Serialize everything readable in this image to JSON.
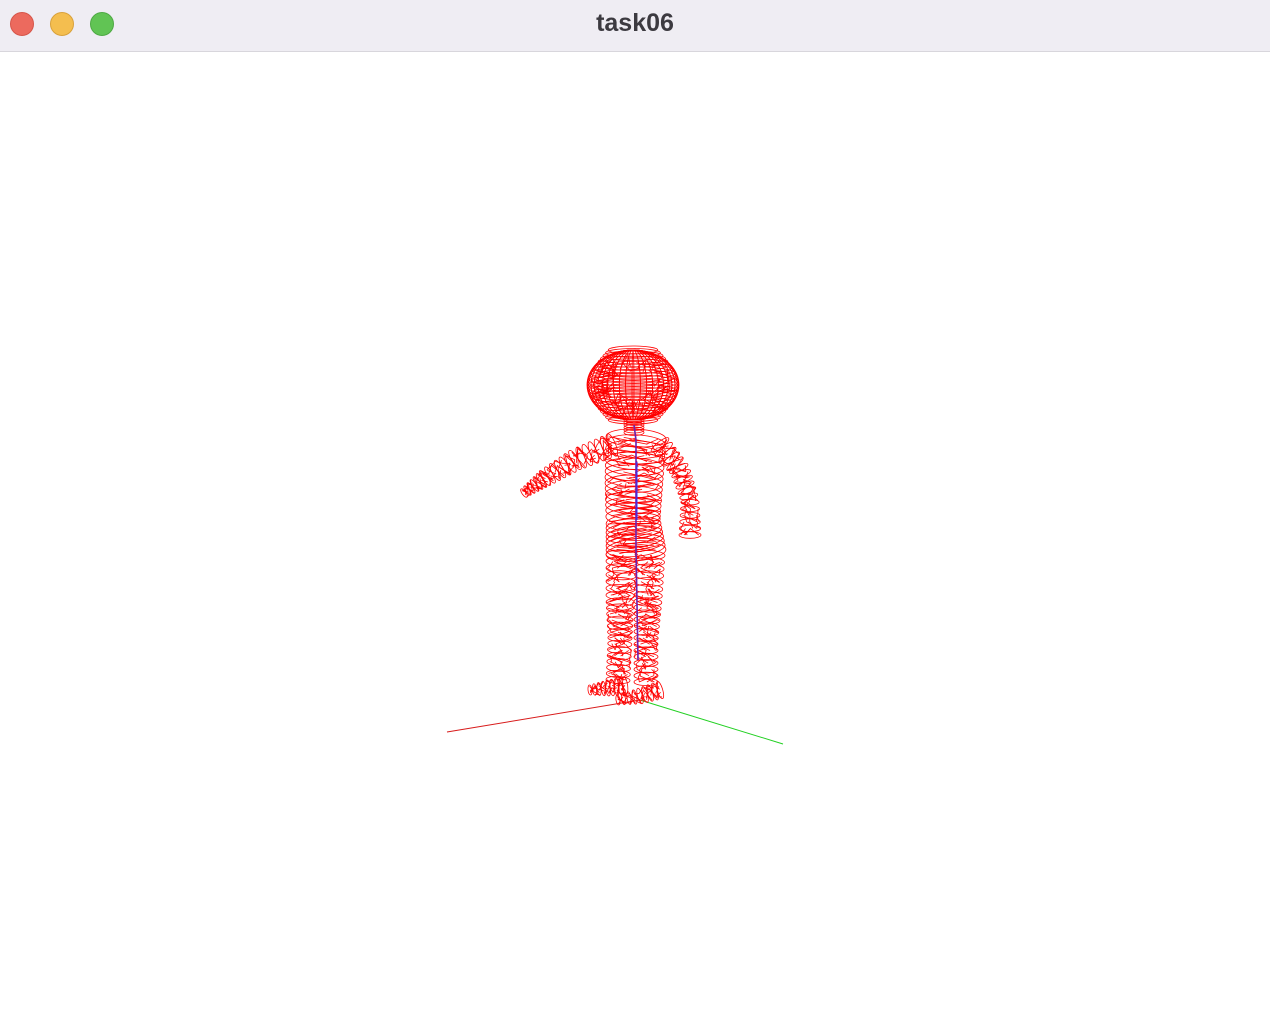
{
  "window": {
    "title": "task06",
    "controls": [
      "close",
      "minimize",
      "maximize"
    ]
  },
  "viewport": {
    "background": "#ffffff",
    "render_mode": "wireframe",
    "mesh_color": "#ff0000",
    "skeleton_color": "#6a1fb0",
    "axes": [
      {
        "name": "x-axis",
        "color": "#d81a1a"
      },
      {
        "name": "y-axis",
        "color": "#22d022"
      },
      {
        "name": "z-axis",
        "color": "#3030ff"
      }
    ]
  }
}
